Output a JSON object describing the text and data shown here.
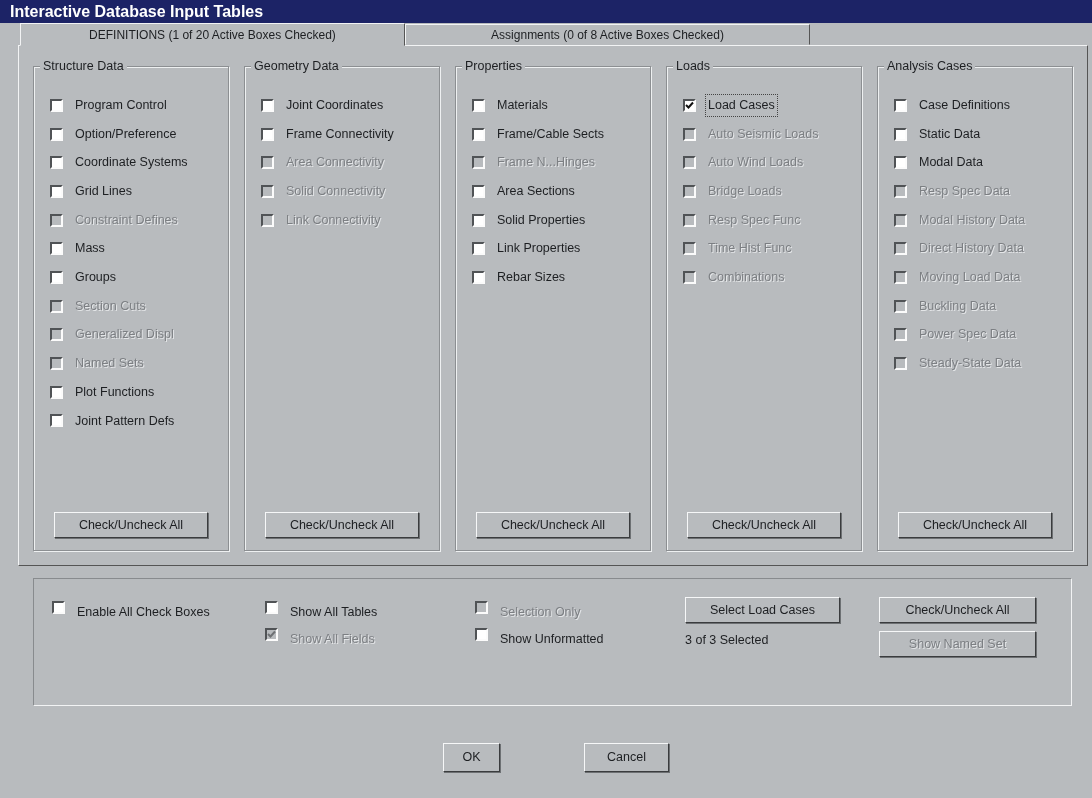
{
  "window": {
    "title": "Interactive Database Input Tables"
  },
  "tabs": [
    {
      "label": "DEFINITIONS (1 of 20 Active Boxes Checked)",
      "selected": true
    },
    {
      "label": "Assignments (0 of 8 Active Boxes Checked)",
      "selected": false
    }
  ],
  "groups": [
    {
      "title": "Structure Data",
      "button": "Check/Uncheck All",
      "items": [
        {
          "label": "Program Control",
          "checked": false,
          "disabled": false,
          "focused": false
        },
        {
          "label": "Option/Preference",
          "checked": false,
          "disabled": false,
          "focused": false
        },
        {
          "label": "Coordinate Systems",
          "checked": false,
          "disabled": false,
          "focused": false
        },
        {
          "label": "Grid Lines",
          "checked": false,
          "disabled": false,
          "focused": false
        },
        {
          "label": "Constraint Defines",
          "checked": false,
          "disabled": true,
          "focused": false
        },
        {
          "label": "Mass",
          "checked": false,
          "disabled": false,
          "focused": false
        },
        {
          "label": "Groups",
          "checked": false,
          "disabled": false,
          "focused": false
        },
        {
          "label": "Section Cuts",
          "checked": false,
          "disabled": true,
          "focused": false
        },
        {
          "label": "Generalized Displ",
          "checked": false,
          "disabled": true,
          "focused": false
        },
        {
          "label": "Named Sets",
          "checked": false,
          "disabled": true,
          "focused": false
        },
        {
          "label": "Plot Functions",
          "checked": false,
          "disabled": false,
          "focused": false
        },
        {
          "label": "Joint Pattern Defs",
          "checked": false,
          "disabled": false,
          "focused": false
        }
      ]
    },
    {
      "title": "Geometry Data",
      "button": "Check/Uncheck All",
      "items": [
        {
          "label": "Joint Coordinates",
          "checked": false,
          "disabled": false,
          "focused": false
        },
        {
          "label": "Frame Connectivity",
          "checked": false,
          "disabled": false,
          "focused": false
        },
        {
          "label": "Area Connectivity",
          "checked": false,
          "disabled": true,
          "focused": false
        },
        {
          "label": "Solid Connectivity",
          "checked": false,
          "disabled": true,
          "focused": false
        },
        {
          "label": "Link Connectivity",
          "checked": false,
          "disabled": true,
          "focused": false
        }
      ]
    },
    {
      "title": "Properties",
      "button": "Check/Uncheck All",
      "items": [
        {
          "label": "Materials",
          "checked": false,
          "disabled": false,
          "focused": false
        },
        {
          "label": "Frame/Cable Sects",
          "checked": false,
          "disabled": false,
          "focused": false
        },
        {
          "label": "Frame N...Hinges",
          "checked": false,
          "disabled": true,
          "focused": false
        },
        {
          "label": "Area Sections",
          "checked": false,
          "disabled": false,
          "focused": false
        },
        {
          "label": "Solid Properties",
          "checked": false,
          "disabled": false,
          "focused": false
        },
        {
          "label": "Link Properties",
          "checked": false,
          "disabled": false,
          "focused": false
        },
        {
          "label": "Rebar Sizes",
          "checked": false,
          "disabled": false,
          "focused": false
        }
      ]
    },
    {
      "title": "Loads",
      "button": "Check/Uncheck All",
      "items": [
        {
          "label": "Load Cases",
          "checked": true,
          "disabled": false,
          "focused": true
        },
        {
          "label": "Auto Seismic Loads",
          "checked": false,
          "disabled": true,
          "focused": false
        },
        {
          "label": "Auto Wind Loads",
          "checked": false,
          "disabled": true,
          "focused": false
        },
        {
          "label": "Bridge Loads",
          "checked": false,
          "disabled": true,
          "focused": false
        },
        {
          "label": "Resp Spec Func",
          "checked": false,
          "disabled": true,
          "focused": false
        },
        {
          "label": "Time Hist Func",
          "checked": false,
          "disabled": true,
          "focused": false
        },
        {
          "label": "Combinations",
          "checked": false,
          "disabled": true,
          "focused": false
        }
      ]
    },
    {
      "title": "Analysis Cases",
      "button": "Check/Uncheck All",
      "items": [
        {
          "label": "Case Definitions",
          "checked": false,
          "disabled": false,
          "focused": false
        },
        {
          "label": "Static Data",
          "checked": false,
          "disabled": false,
          "focused": false
        },
        {
          "label": "Modal Data",
          "checked": false,
          "disabled": false,
          "focused": false
        },
        {
          "label": "Resp Spec Data",
          "checked": false,
          "disabled": true,
          "focused": false
        },
        {
          "label": "Modal History Data",
          "checked": false,
          "disabled": true,
          "focused": false
        },
        {
          "label": "Direct History Data",
          "checked": false,
          "disabled": true,
          "focused": false
        },
        {
          "label": "Moving Load Data",
          "checked": false,
          "disabled": true,
          "focused": false
        },
        {
          "label": "Buckling Data",
          "checked": false,
          "disabled": true,
          "focused": false
        },
        {
          "label": "Power Spec Data",
          "checked": false,
          "disabled": true,
          "focused": false
        },
        {
          "label": "Steady-State Data",
          "checked": false,
          "disabled": true,
          "focused": false
        }
      ]
    }
  ],
  "options": [
    [
      {
        "label": "Enable All Check Boxes",
        "checked": false,
        "disabled": false
      }
    ],
    [
      {
        "label": "Show All Tables",
        "checked": false,
        "disabled": false
      },
      {
        "label": "Show All Fields",
        "checked": true,
        "disabled": true
      }
    ],
    [
      {
        "label": "Selection Only",
        "checked": false,
        "disabled": true
      },
      {
        "label": "Show Unformatted",
        "checked": false,
        "disabled": false
      }
    ]
  ],
  "load_cases": {
    "button": "Select Load Cases",
    "status": "3 of 3 Selected"
  },
  "side_buttons": [
    {
      "label": "Check/Uncheck All",
      "disabled": false
    },
    {
      "label": "Show Named Set",
      "disabled": true
    }
  ],
  "dialog_buttons": [
    "OK",
    "Cancel"
  ]
}
